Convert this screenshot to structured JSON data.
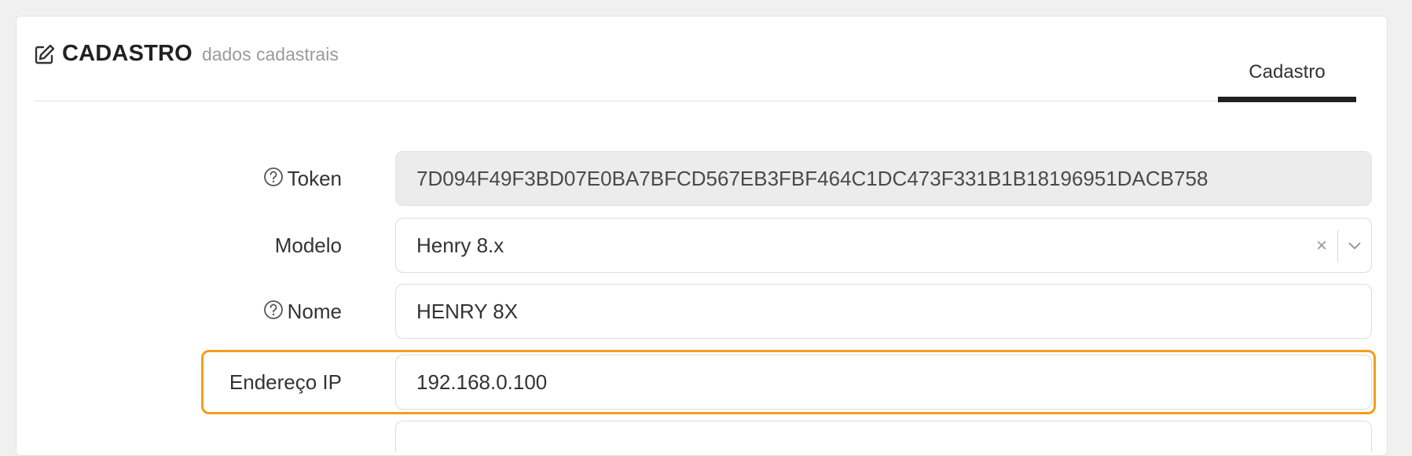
{
  "header": {
    "title": "CADASTRO",
    "subtitle": "dados cadastrais",
    "icon": "edit-icon"
  },
  "tabs": [
    {
      "label": "Cadastro",
      "active": true
    }
  ],
  "form": {
    "token": {
      "label": "Token",
      "value": "7D094F49F3BD07E0BA7BFCD567EB3FBF464C1DC473F331B1B18196951DACB758",
      "help_icon": "question-circle-icon"
    },
    "modelo": {
      "label": "Modelo",
      "value": "Henry 8.x",
      "clear_symbol": "×"
    },
    "nome": {
      "label": "Nome",
      "value": "HENRY 8X",
      "help_icon": "question-circle-icon"
    },
    "endereco_ip": {
      "label": "Endereço IP",
      "value": "192.168.0.100"
    }
  },
  "colors": {
    "highlight": "#f29e1c",
    "tab_underline": "#1e2320",
    "readonly_bg": "#ececec"
  }
}
